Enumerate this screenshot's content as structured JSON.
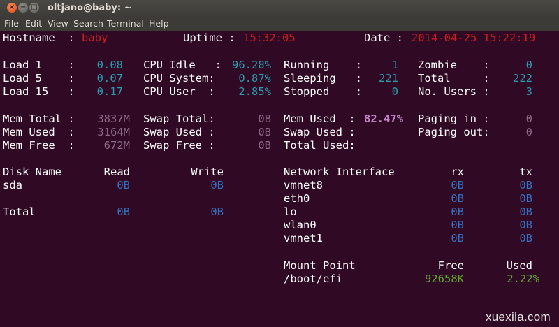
{
  "window": {
    "title": "oltjano@baby: ~",
    "menu": [
      "File",
      "Edit",
      "View",
      "Search",
      "Terminal",
      "Help"
    ]
  },
  "header": {
    "hostname_label": "Hostname  :",
    "hostname": "baby",
    "uptime_label": "Uptime :",
    "uptime": "15:32:05",
    "date_label": "Date :",
    "date": "2014-04-25 15:22:19"
  },
  "cpu": {
    "load1_label": "Load 1    :",
    "load1": "0.08",
    "load5_label": "Load 5    :",
    "load5": "0.07",
    "load15_label": "Load 15   :",
    "load15": "0.17",
    "idle_label": "CPU Idle   :",
    "idle": "96.28%",
    "system_label": "CPU System:",
    "system": "0.87%",
    "user_label": "CPU User  :",
    "user": "2.85%"
  },
  "procs": {
    "running_label": "Running    :",
    "running": "1",
    "sleeping_label": "Sleeping   :",
    "sleeping": "221",
    "stopped_label": "Stopped    :",
    "stopped": "0",
    "zombie_label": "Zombie    :",
    "zombie": "0",
    "total_label": "Total     :",
    "total": "222",
    "users_label": "No. Users :",
    "users": "3"
  },
  "mem": {
    "total_label": "Mem Total :",
    "total": "3837M",
    "used_label": "Mem Used  :",
    "used": "3164M",
    "free_label": "Mem Free  :",
    "free": "672M",
    "swap_total_label": "Swap Total:",
    "swap_total": "0B",
    "swap_used_label": "Swap Used :",
    "swap_used": "0B",
    "swap_free_label": "Swap Free :",
    "swap_free": "0B",
    "mem_used_pct_label": "Mem Used  :",
    "mem_used_pct": "82.47%",
    "swap_used2_label": "Swap Used :",
    "total_used_label": "Total Used:",
    "paging_in_label": "Paging in :",
    "paging_in": "0",
    "paging_out_label": "Paging out:",
    "paging_out": "0"
  },
  "disk": {
    "headers": {
      "name": "Disk Name",
      "read": "Read",
      "write": "Write"
    },
    "rows": [
      {
        "name": "sda",
        "read": "0B",
        "write": "0B"
      }
    ],
    "total": {
      "name": "Total",
      "read": "0B",
      "write": "0B"
    }
  },
  "network": {
    "headers": {
      "name": "Network Interface",
      "rx": "rx",
      "tx": "tx"
    },
    "rows": [
      {
        "name": "vmnet8",
        "rx": "0B",
        "tx": "0B"
      },
      {
        "name": "eth0",
        "rx": "0B",
        "tx": "0B"
      },
      {
        "name": "lo",
        "rx": "0B",
        "tx": "0B"
      },
      {
        "name": "wlan0",
        "rx": "0B",
        "tx": "0B"
      },
      {
        "name": "vmnet1",
        "rx": "0B",
        "tx": "0B"
      }
    ]
  },
  "mounts": {
    "headers": {
      "point": "Mount Point",
      "free": "Free",
      "used": "Used"
    },
    "rows": [
      {
        "point": "/boot/efi",
        "free": "92658K",
        "used": "2.22%"
      }
    ]
  },
  "watermark": "xuexila.com"
}
